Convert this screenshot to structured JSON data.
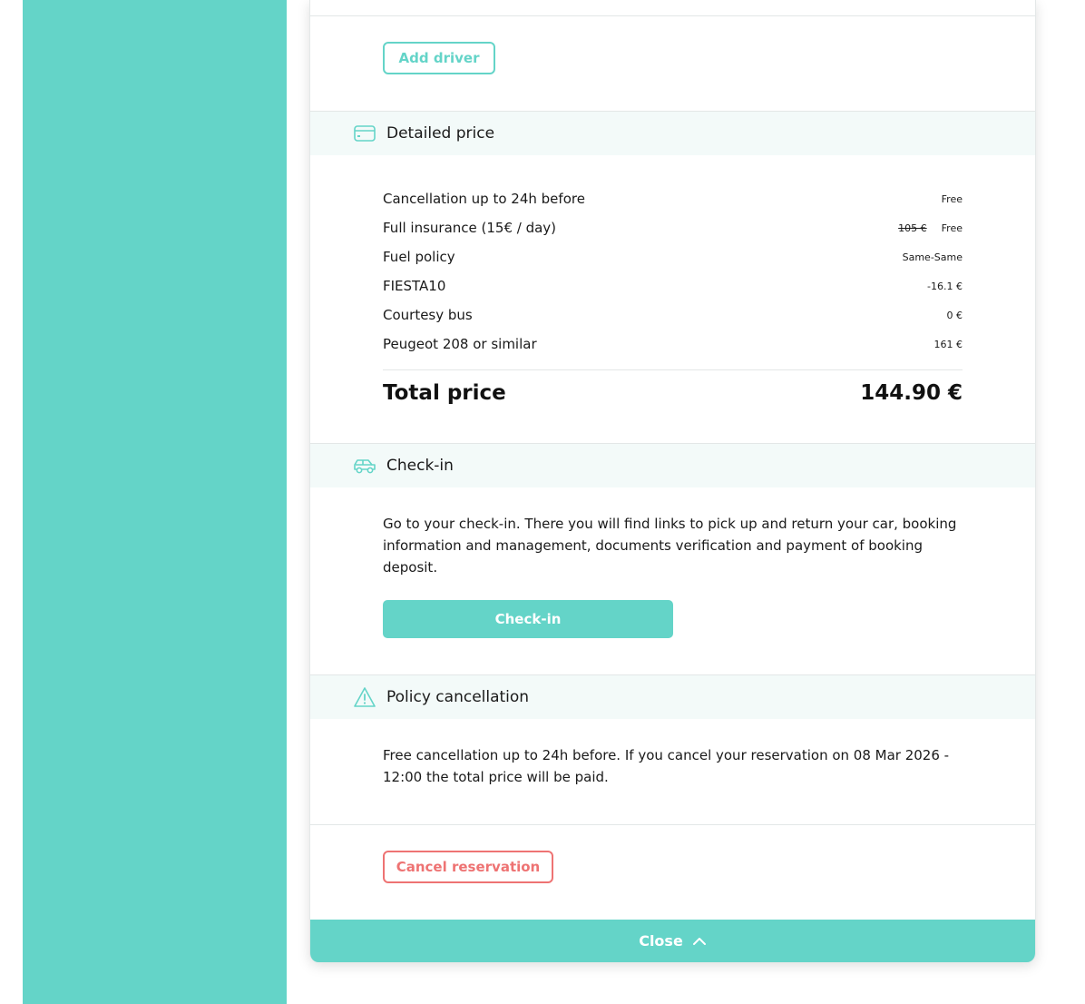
{
  "drivers": {
    "add_driver_label": "Add driver"
  },
  "detailed_price": {
    "title": "Detailed price",
    "icon": "credit-card-icon",
    "rows": [
      {
        "label": "Cancellation up to 24h before",
        "value": "Free"
      },
      {
        "label": "Full insurance (15€ / day)",
        "original": "105 €",
        "value": "Free"
      },
      {
        "label": "Fuel policy",
        "value": "Same-Same"
      },
      {
        "label": "FIESTA10",
        "value": "-16.1 €"
      },
      {
        "label": "Courtesy bus",
        "value": "0 €"
      },
      {
        "label": "Peugeot 208 or similar",
        "value": "161 €"
      }
    ],
    "total_label": "Total price",
    "total_value": "144.90 €"
  },
  "checkin": {
    "title": "Check-in",
    "icon": "car-icon",
    "description": "Go to your check-in. There you will find links to pick up and return your car, booking information and management, documents verification and payment of booking deposit.",
    "button_label": "Check-in"
  },
  "policy": {
    "title": "Policy cancellation",
    "icon": "warning-icon",
    "description": "Free cancellation up to 24h before. If you cancel your reservation on 08 Mar 2026 - 12:00 the total price will be paid."
  },
  "cancel_label": "Cancel reservation",
  "close_label": "Close",
  "colors": {
    "accent": "#64d4c8",
    "danger": "#ee7373",
    "section_bg": "#f3faf9"
  }
}
